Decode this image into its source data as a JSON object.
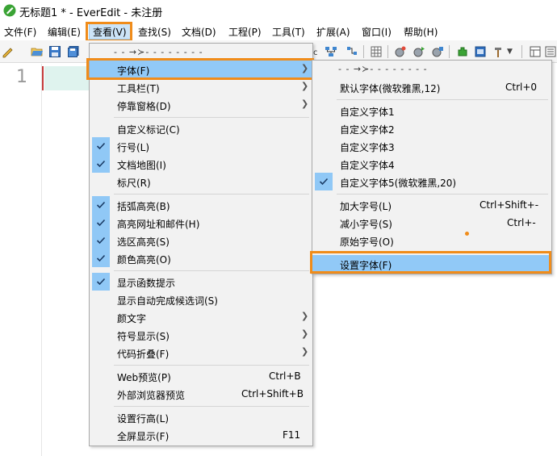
{
  "window": {
    "title": "无标题1 * - EverEdit - 未注册"
  },
  "menubar": [
    {
      "label": "文件(F)"
    },
    {
      "label": "编辑(E)"
    },
    {
      "label": "查看(V)"
    },
    {
      "label": "查找(S)"
    },
    {
      "label": "文档(D)"
    },
    {
      "label": "工程(P)"
    },
    {
      "label": "工具(T)"
    },
    {
      "label": "扩展(A)"
    },
    {
      "label": "窗口(I)"
    },
    {
      "label": "帮助(H)"
    }
  ],
  "editor": {
    "line_number": "1"
  },
  "view_menu": {
    "tearoff": "- - →≻- - - - - - - -",
    "items": [
      {
        "label": "字体(F)",
        "submenu": true,
        "checked": false,
        "highlighted": true
      },
      {
        "label": "工具栏(T)",
        "submenu": true,
        "checked": false
      },
      {
        "label": "停靠窗格(D)",
        "submenu": true,
        "checked": false
      },
      {
        "label": "自定义标记(C)",
        "checked": false
      },
      {
        "label": "行号(L)",
        "checked": true
      },
      {
        "label": "文档地图(I)",
        "checked": true
      },
      {
        "label": "标尺(R)",
        "checked": false
      },
      {
        "label": "括弧高亮(B)",
        "checked": true
      },
      {
        "label": "高亮网址和邮件(H)",
        "checked": true
      },
      {
        "label": "选区高亮(S)",
        "checked": true
      },
      {
        "label": "颜色高亮(O)",
        "checked": true
      },
      {
        "label": "显示函数提示",
        "checked": true
      },
      {
        "label": "显示自动完成候选词(S)",
        "checked": false
      },
      {
        "label": "颜文字",
        "submenu": true,
        "checked": false
      },
      {
        "label": "符号显示(S)",
        "submenu": true,
        "checked": false
      },
      {
        "label": "代码折叠(F)",
        "submenu": true,
        "checked": false
      },
      {
        "label": "Web预览(P)",
        "shortcut": "Ctrl+B",
        "checked": false
      },
      {
        "label": "外部浏览器预览",
        "shortcut": "Ctrl+Shift+B",
        "checked": false
      },
      {
        "label": "设置行高(L)",
        "checked": false
      },
      {
        "label": "全屏显示(F)",
        "shortcut": "F11",
        "checked": false
      }
    ]
  },
  "font_submenu": {
    "tearoff": "- - →≻- - - - - - - -",
    "items": [
      {
        "label": "默认字体(微软雅黑,12)",
        "shortcut": "Ctrl+0",
        "checked": false
      },
      {
        "label": "自定义字体1",
        "checked": false
      },
      {
        "label": "自定义字体2",
        "checked": false
      },
      {
        "label": "自定义字体3",
        "checked": false
      },
      {
        "label": "自定义字体4",
        "checked": false
      },
      {
        "label": "自定义字体5(微软雅黑,20)",
        "checked": true
      },
      {
        "label": "加大字号(L)",
        "shortcut": "Ctrl+Shift+-",
        "checked": false
      },
      {
        "label": "减小字号(S)",
        "shortcut": "Ctrl+-",
        "checked": false
      },
      {
        "label": "原始字号(O)",
        "checked": false
      },
      {
        "label": "设置字体(F)",
        "checked": false,
        "highlighted": true
      }
    ]
  },
  "colors": {
    "accent_highlight": "#f08c1a",
    "menu_selection": "#91c9f7",
    "check_background": "#90c8f6"
  },
  "icons": [
    "app-icon",
    "new-file-icon",
    "open-folder-icon",
    "save-icon",
    "save-all-icon",
    "check-icon",
    "submenu-arrow-icon"
  ]
}
